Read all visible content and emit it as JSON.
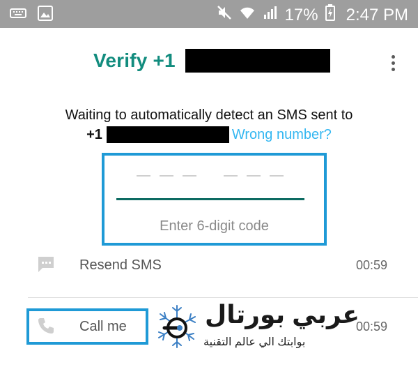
{
  "status_bar": {
    "battery": "17%",
    "time": "2:47 PM"
  },
  "header": {
    "title": "Verify +1"
  },
  "message": {
    "line1": "Waiting to automatically detect an SMS sent to",
    "prefix": "+1",
    "wrong_number": "Wrong number?"
  },
  "code_entry": {
    "hint": "Enter 6-digit code",
    "digit_count": 6
  },
  "actions": {
    "resend_label": "Resend SMS",
    "resend_timer": "00:59",
    "call_label": "Call me",
    "call_timer": "00:59"
  },
  "watermark": {
    "title": "عربي بورتال",
    "subtitle": "بوابتك الي عالم التقنية"
  },
  "colors": {
    "accent": "#128c7e",
    "link": "#34b7f1",
    "highlight": "#1f9ad6"
  }
}
